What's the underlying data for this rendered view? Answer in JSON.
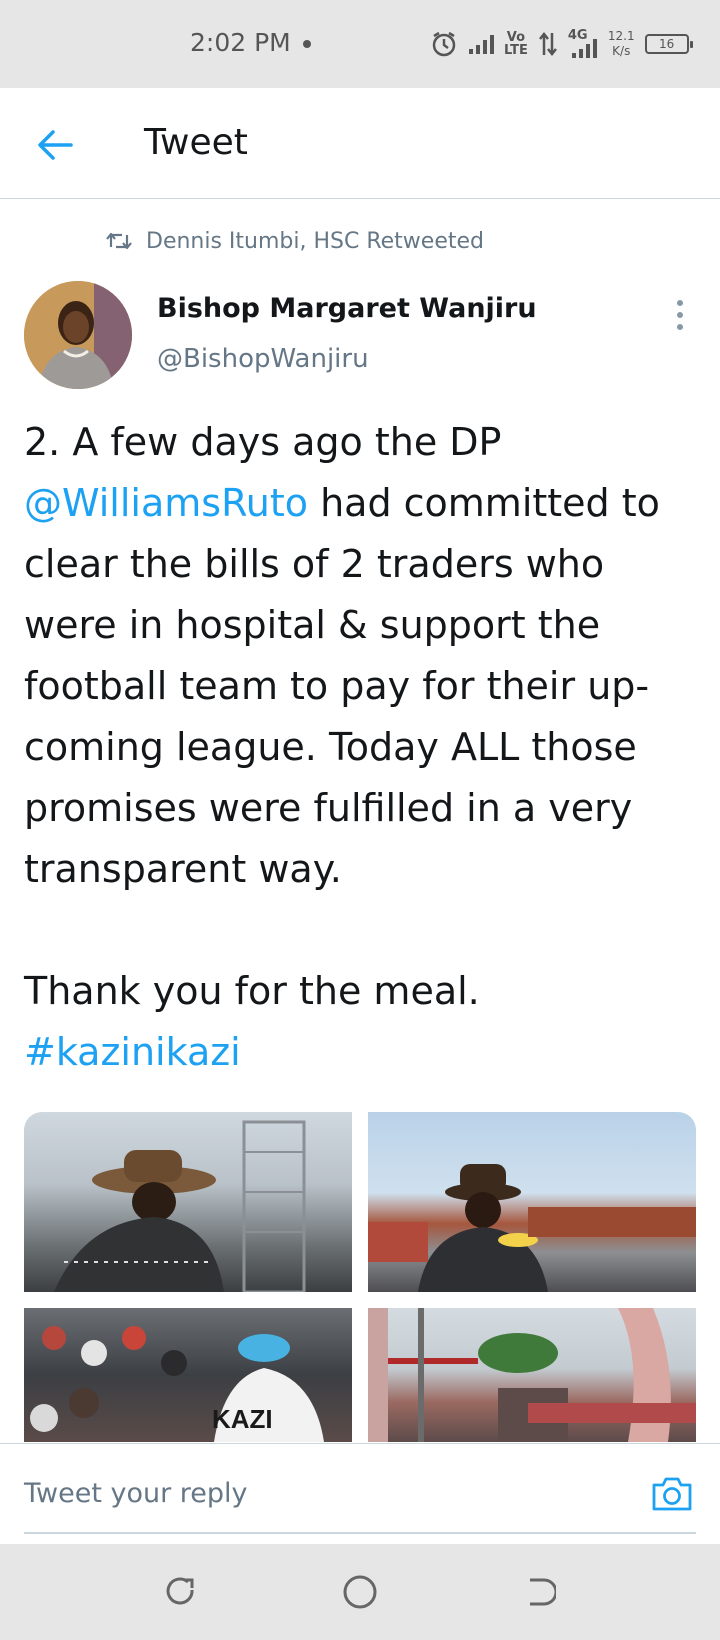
{
  "status_bar": {
    "time": "2:02 PM",
    "network_volte": "Vo\nLTE",
    "network_4g": "4G",
    "speed_value": "12.1",
    "speed_unit": "K/s",
    "battery": "16",
    "icons": [
      "alarm-icon",
      "signal-icon",
      "volte-icon",
      "data-arrows-icon",
      "4g-signal-icon",
      "battery-icon"
    ]
  },
  "header": {
    "title": "Tweet",
    "back_icon": "arrow-left-icon",
    "accent_color": "#1da1f2"
  },
  "tweet": {
    "retweeted_by": "Dennis Itumbi, HSC Retweeted",
    "author_name": "Bishop Margaret Wanjiru",
    "author_handle": "@BishopWanjiru",
    "text_line_1_a": "2. A few days ago the DP",
    "mention": "@WilliamsRuto",
    "text_line_1_b": " had committed to clear the bills of 2 traders who were in hospital & support the football team to pay for their up-coming league. Today ALL those promises were fulfilled in a very transparent way.",
    "text_line_2": "Thank you for the meal.",
    "hashtag": "#kazinikazi",
    "media_labels": [
      "",
      "",
      "KAZI",
      ""
    ]
  },
  "reply": {
    "placeholder": "Tweet your reply"
  },
  "nav": {
    "icons": [
      "recent-apps-icon",
      "home-icon",
      "back-icon"
    ]
  }
}
